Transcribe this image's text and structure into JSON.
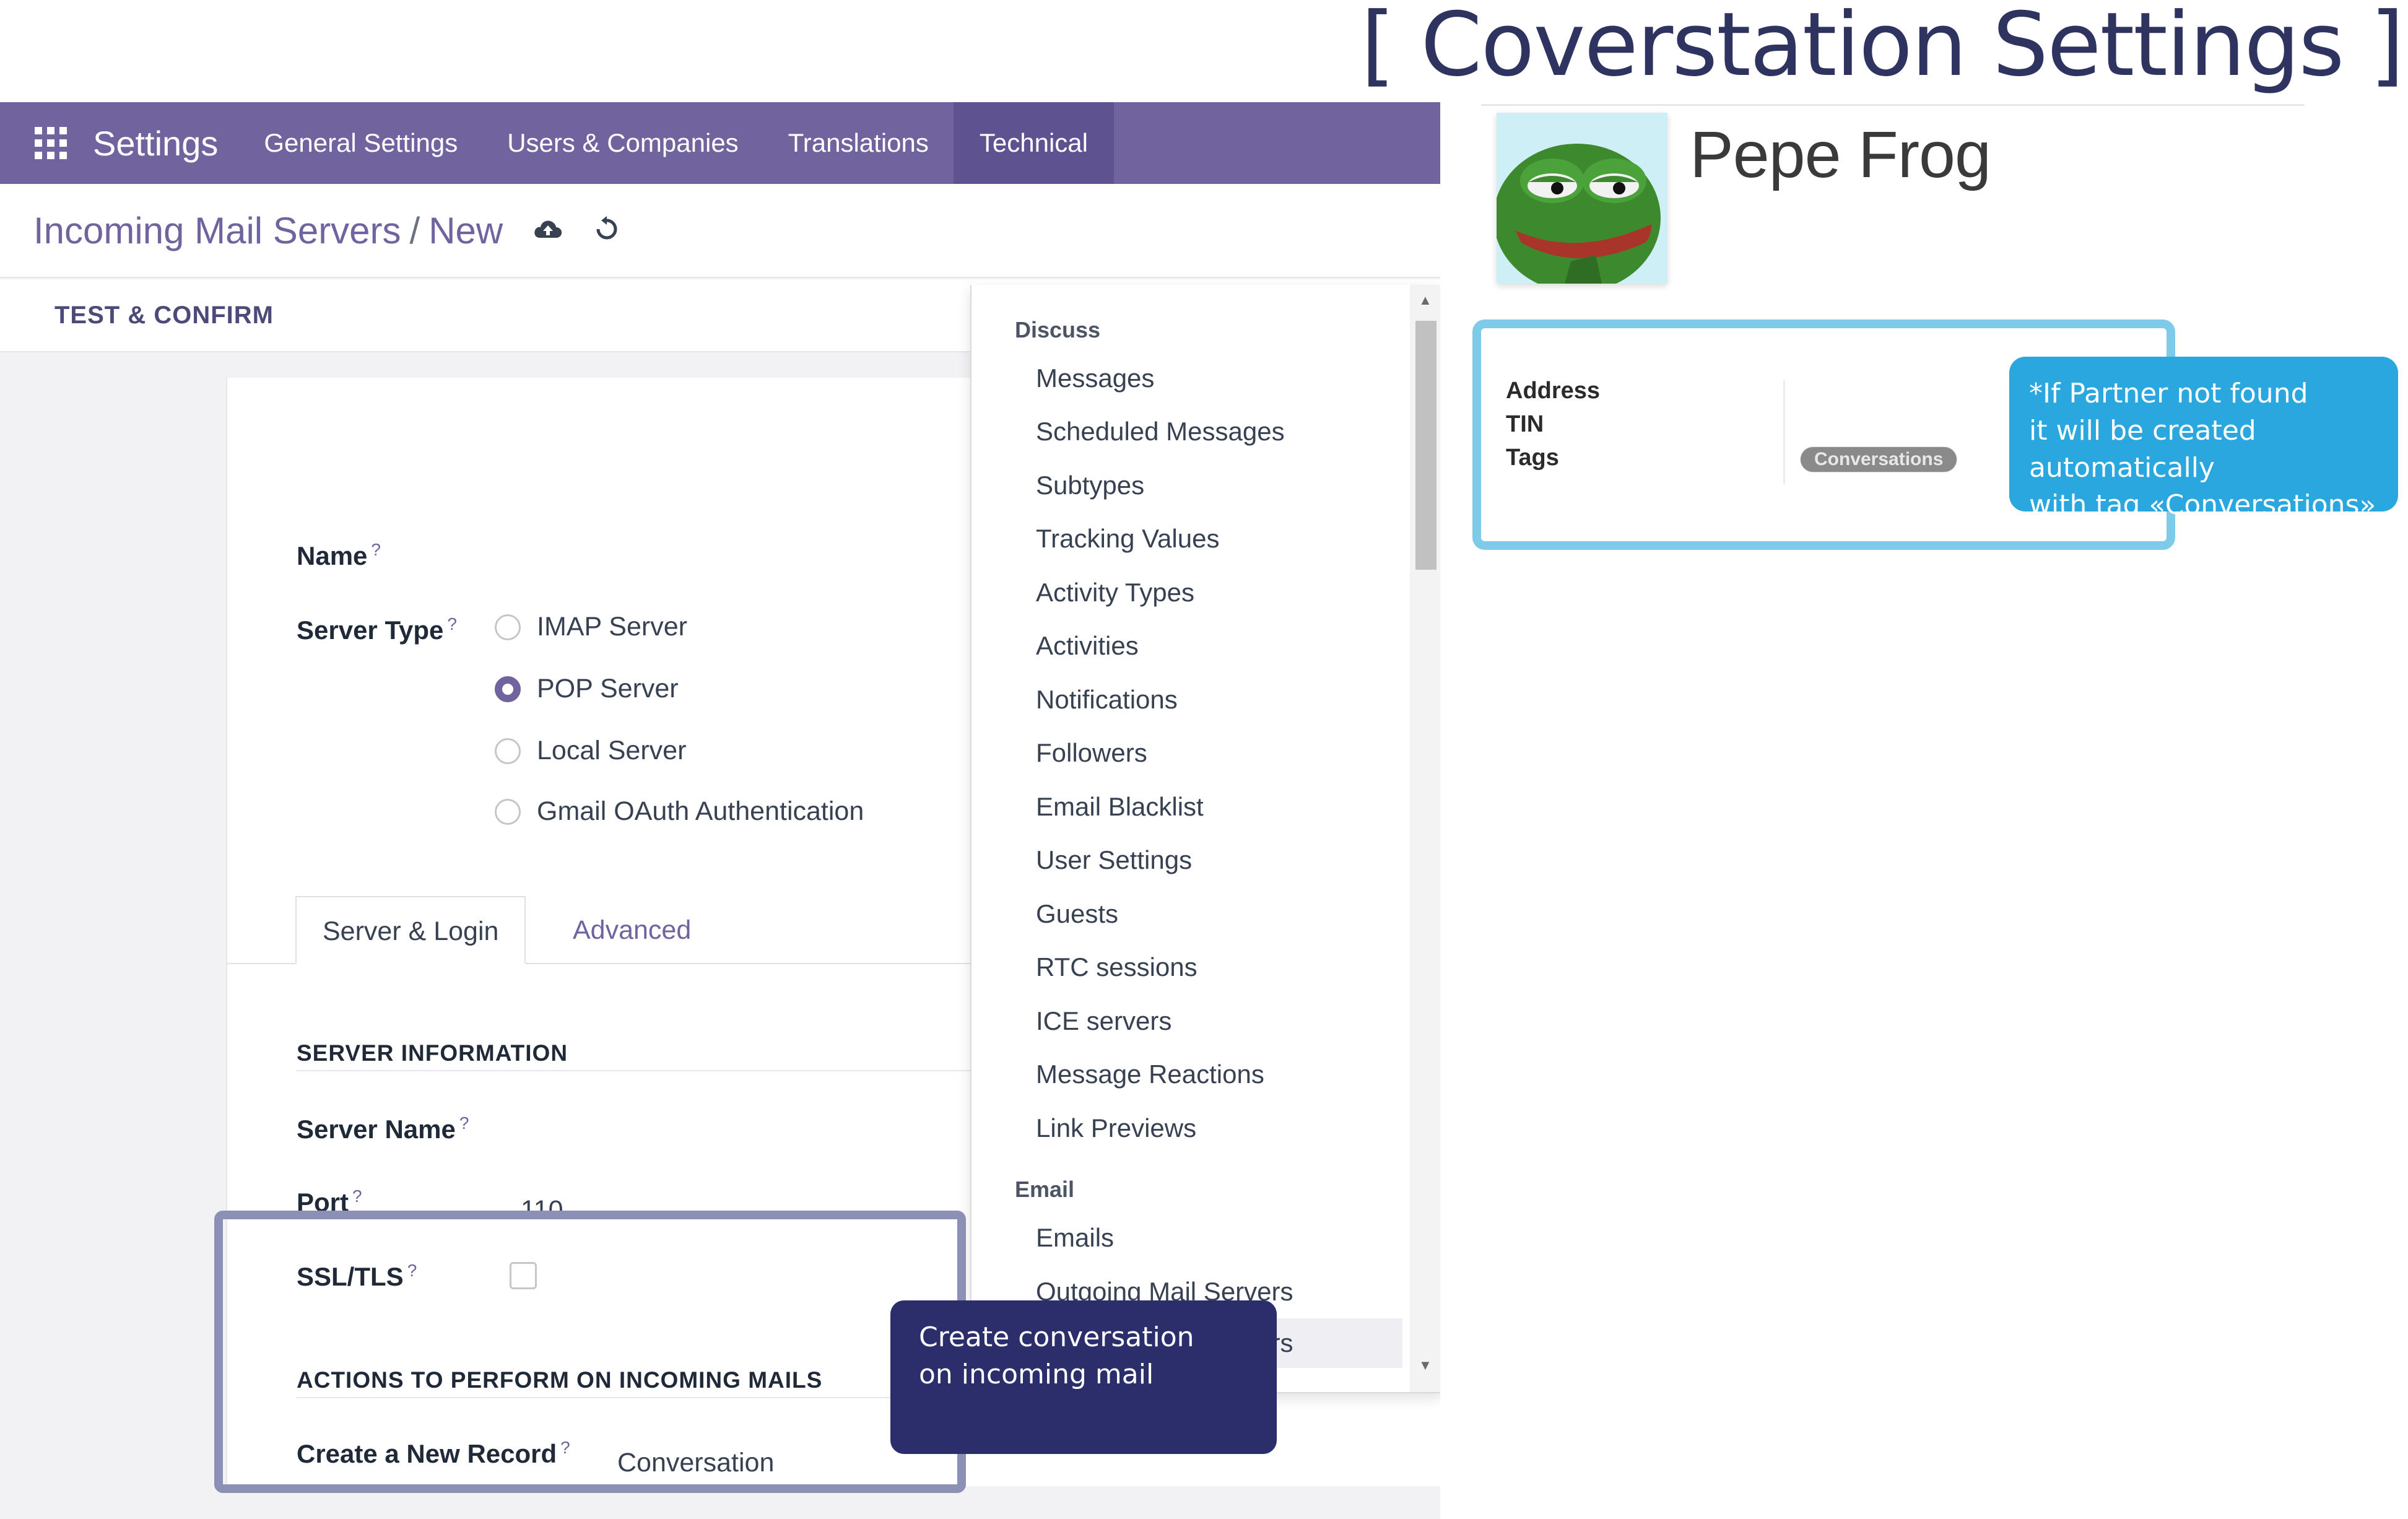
{
  "page_heading": "[ Coverstation Settings ]",
  "navbar": {
    "app_name": "Settings",
    "menu": [
      {
        "label": "General Settings"
      },
      {
        "label": "Users & Companies"
      },
      {
        "label": "Translations"
      },
      {
        "label": "Technical"
      }
    ]
  },
  "breadcrumb": {
    "parent": "Incoming Mail Servers",
    "separator": "/",
    "current": "New"
  },
  "statusbar": {
    "test_confirm": "TEST & CONFIRM"
  },
  "form": {
    "name_label": "Name",
    "server_type_label": "Server Type",
    "server_types": [
      {
        "label": "IMAP Server",
        "checked": false
      },
      {
        "label": "POP Server",
        "checked": true
      },
      {
        "label": "Local Server",
        "checked": false
      },
      {
        "label": "Gmail OAuth Authentication",
        "checked": false
      }
    ],
    "tabs": [
      {
        "label": "Server & Login"
      },
      {
        "label": "Advanced"
      }
    ],
    "server_info_title": "SERVER INFORMATION",
    "server_name_label": "Server Name",
    "port_label": "Port",
    "port_value": "110",
    "ssl_label": "SSL/TLS",
    "ssl_checked": false,
    "actions_title": "ACTIONS TO PERFORM ON INCOMING MAILS",
    "create_record_label": "Create a New Record",
    "create_record_value": "Conversation",
    "help_mark": "?"
  },
  "dropdown": {
    "sections": [
      {
        "header": "Discuss",
        "items": [
          "Messages",
          "Scheduled Messages",
          "Subtypes",
          "Tracking Values",
          "Activity Types",
          "Activities",
          "Notifications",
          "Followers",
          "Email Blacklist",
          "User Settings",
          "Guests",
          "RTC sessions",
          "ICE servers",
          "Message Reactions",
          "Link Previews"
        ]
      },
      {
        "header": "Email",
        "items": [
          "Emails",
          "Outgoing Mail Servers",
          "Incoming Mail Servers"
        ]
      }
    ],
    "selected_item": "Incoming Mail Servers"
  },
  "callout_dark": {
    "line1": "Create conversation",
    "line2": "on incoming mail"
  },
  "partner": {
    "name": "Pepe Frog",
    "fields": [
      {
        "label": "Address"
      },
      {
        "label": "TIN"
      },
      {
        "label": "Tags"
      }
    ],
    "tag": "Conversations"
  },
  "callout_blue": {
    "line1": "*If Partner not found",
    "line2": "it will be created automatically",
    "line3": "with tag «Conversations»"
  },
  "colors": {
    "navbar": "#71639e",
    "navbar_active": "#5e5290",
    "heading": "#2f3360",
    "callout_dark": "#2b2e6b",
    "callout_blue": "#2ba7df",
    "info_border": "#7dcbe8",
    "actions_border": "#8c90b7"
  }
}
